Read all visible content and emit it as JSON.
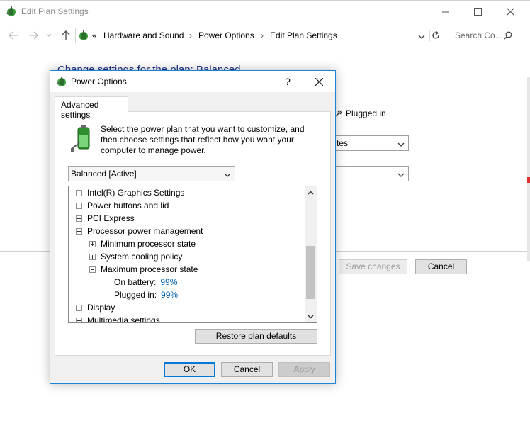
{
  "window": {
    "title": "Edit Plan Settings"
  },
  "address_bar": {
    "overflow_chevron": "«",
    "crumbs": [
      "Hardware and Sound",
      "Power Options",
      "Edit Plan Settings"
    ],
    "separator": "›"
  },
  "search": {
    "placeholder": "Search Co..."
  },
  "background": {
    "heading": "Change settings for the plan: Balanced",
    "plugged_in_label": "Plugged in",
    "select_1_value": "tes",
    "select_2_value": "",
    "save_changes_label": "Save changes",
    "cancel_label": "Cancel"
  },
  "dialog": {
    "title": "Power Options",
    "help_label": "?",
    "tab_label": "Advanced settings",
    "description": "Select the power plan that you want to customize, and then choose settings that reflect how you want your computer to manage power.",
    "plan_select_value": "Balanced [Active]",
    "tree": [
      {
        "label": "Intel(R) Graphics Settings",
        "expander": "plus",
        "level": 0
      },
      {
        "label": "Power buttons and lid",
        "expander": "plus",
        "level": 0
      },
      {
        "label": "PCI Express",
        "expander": "plus",
        "level": 0
      },
      {
        "label": "Processor power management",
        "expander": "minus",
        "level": 0
      },
      {
        "label": "Minimum processor state",
        "expander": "plus",
        "level": 1
      },
      {
        "label": "System cooling policy",
        "expander": "plus",
        "level": 1
      },
      {
        "label": "Maximum processor state",
        "expander": "minus",
        "level": 1
      },
      {
        "label": "On battery:",
        "value": "99%",
        "level": 2
      },
      {
        "label": "Plugged in:",
        "value": "99%",
        "level": 2
      },
      {
        "label": "Display",
        "expander": "plus",
        "level": 0
      },
      {
        "label": "Multimedia settings",
        "expander": "plus",
        "level": 0
      }
    ],
    "restore_label": "Restore plan defaults",
    "ok_label": "OK",
    "cancel_label": "Cancel",
    "apply_label": "Apply"
  },
  "icons": {
    "app": "power-options-icon",
    "battery": "battery-plug-icon",
    "refresh": "refresh-icon",
    "search": "search-icon"
  }
}
